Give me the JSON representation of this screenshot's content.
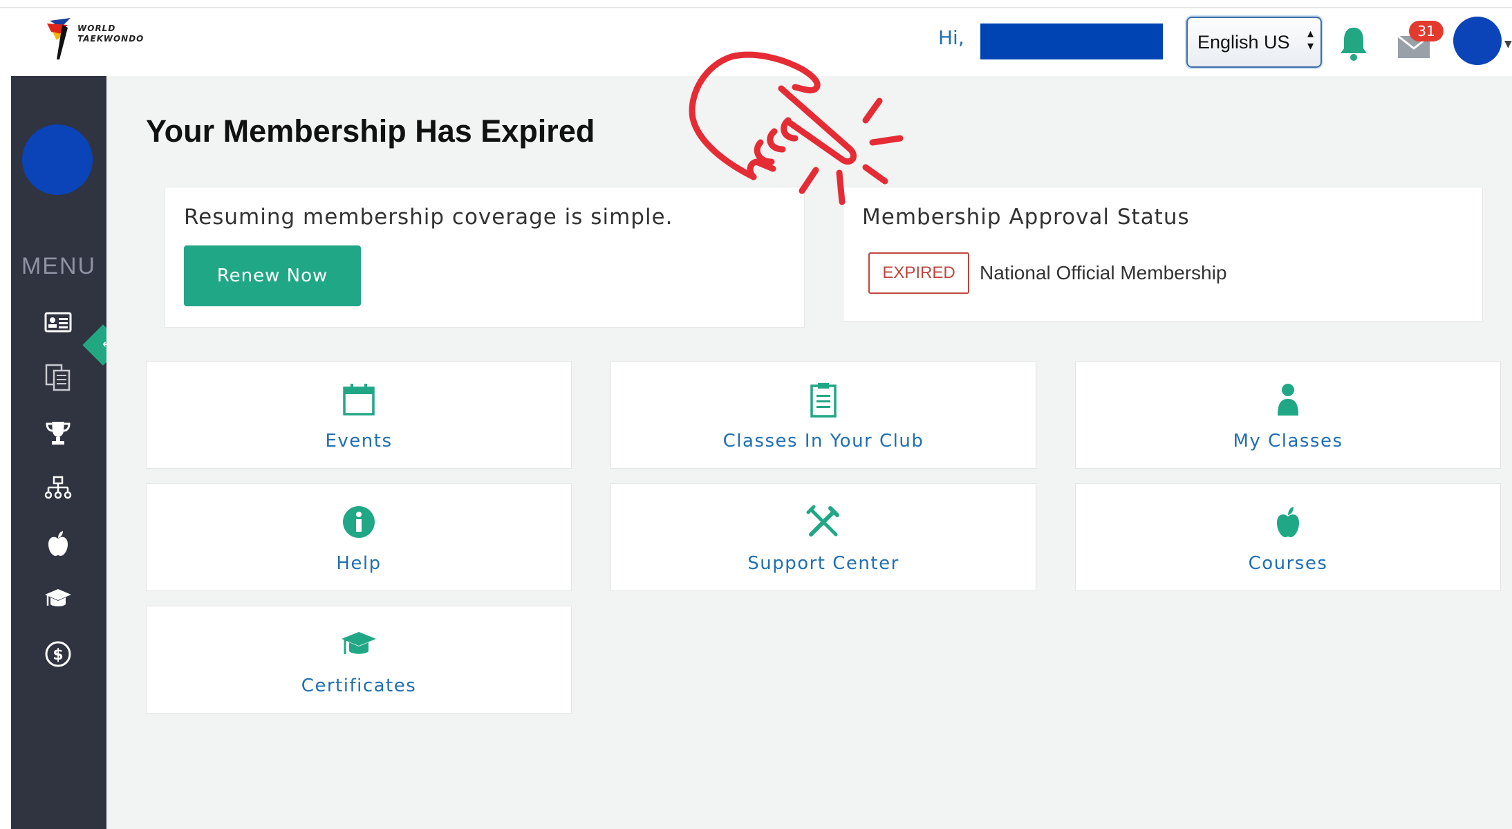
{
  "header": {
    "logo_text_line1": "WORLD",
    "logo_text_line2": "TAEKWONDO",
    "greeting": "Hi,",
    "language": "English US",
    "mail_badge_count": "31",
    "colors": {
      "greeting": "#1f6fb5",
      "badge": "#e23b2e",
      "bell": "#22a783"
    }
  },
  "sidebar": {
    "menu_label": "MENU",
    "toggle_label": "↔",
    "items": [
      {
        "icon": "id-card-icon"
      },
      {
        "icon": "documents-icon"
      },
      {
        "icon": "trophy-icon"
      },
      {
        "icon": "org-chart-icon"
      },
      {
        "icon": "apple-icon"
      },
      {
        "icon": "graduation-cap-icon"
      },
      {
        "icon": "dollar-icon"
      }
    ]
  },
  "main": {
    "title": "Your Membership Has Expired",
    "renew_card": {
      "message": "Resuming membership coverage is simple.",
      "button_label": "Renew Now"
    },
    "status_card": {
      "title": "Membership Approval Status",
      "status": "EXPIRED",
      "membership_type": "National Official Membership"
    },
    "tiles": [
      {
        "label": "Events",
        "icon": "calendar-icon"
      },
      {
        "label": "Classes In Your Club",
        "icon": "clipboard-icon"
      },
      {
        "label": "My Classes",
        "icon": "person-icon"
      },
      {
        "label": "Help",
        "icon": "info-icon"
      },
      {
        "label": "Support Center",
        "icon": "tools-icon"
      },
      {
        "label": "Courses",
        "icon": "apple-icon"
      },
      {
        "label": "Certificates",
        "icon": "graduation-cap-icon"
      }
    ],
    "colors": {
      "accent": "#20a785",
      "link": "#1f6fb5",
      "expired": "#c0453e"
    }
  }
}
